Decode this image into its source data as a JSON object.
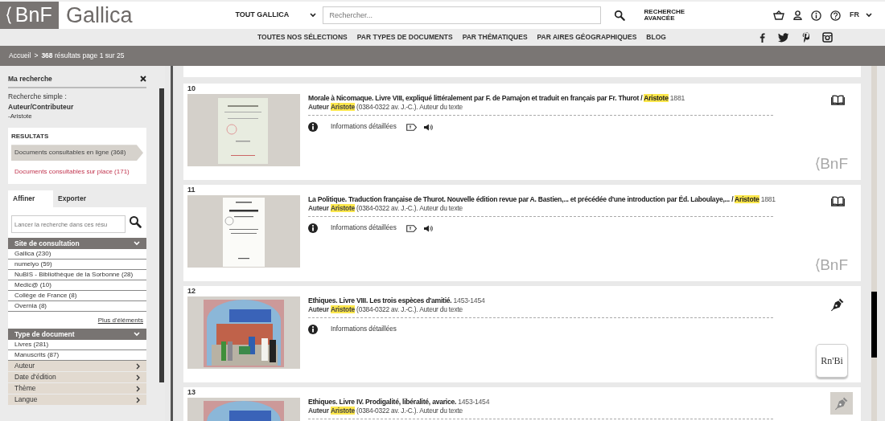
{
  "header": {
    "logo": "BnF",
    "site_name": "Gallica",
    "scope": "TOUT GALLICA",
    "search_placeholder": "Rechercher...",
    "advanced_search": "RECHERCHE AVANCÉE",
    "language": "FR"
  },
  "nav": [
    "TOUTES NOS SÉLECTIONS",
    "PAR TYPES DE DOCUMENTS",
    "PAR THÉMATIQUES",
    "PAR AIRES GÉOGRAPHIQUES",
    "BLOG"
  ],
  "breadcrumb": {
    "home": "Accueil",
    "separator": ">",
    "summary": "**368** résultats page 1 sur 25"
  },
  "sidebar": {
    "title": "Ma recherche",
    "query_type": "Recherche simple :",
    "query_field": "Auteur/Contributeur",
    "query_value": "-Aristote",
    "results_heading": "RESULTATS",
    "result_sets": [
      {
        "label": "Documents consultables en ligne (368)",
        "selected": true
      },
      {
        "label": "Documents consultables sur place (171)",
        "selected": false
      }
    ],
    "tabs": [
      {
        "label": "Affiner",
        "selected": true
      },
      {
        "label": "Exporter",
        "selected": false
      }
    ],
    "filter_placeholder": "Lancer la recherche dans ces résu",
    "facets": [
      {
        "title": "Site de consultation",
        "expanded": true,
        "items": [
          "Gallica (230)",
          "numelyo (59)",
          "NuBIS - Bibliothèque de la Sorbonne (28)",
          "Medic@ (10)",
          "Collège de France (8)",
          "Overnia (8)"
        ],
        "more": "Plus d'éléments"
      },
      {
        "title": "Type de document",
        "expanded": true,
        "items": [
          "Livres (281)",
          "Manuscrits (87)"
        ]
      },
      {
        "title": "Auteur",
        "expanded": false
      },
      {
        "title": "Date d'édition",
        "expanded": false
      },
      {
        "title": "Thème",
        "expanded": false
      },
      {
        "title": "Langue",
        "expanded": false
      }
    ]
  },
  "results": [
    {
      "number": "10",
      "title": "Morale à Nicomaque. Livre VIII, expliqué littéralement par F. de Parnajon et traduit en français par Fr. Thurot / ",
      "title_author": "Aristote",
      "date": "1881",
      "author_label": "Auteur",
      "author_name": "Aristote",
      "author_rest": "(0384-0322 av. J.-C.). Auteur du texte",
      "details": "Informations détaillées",
      "actions": [
        {
          "kind": "tag"
        },
        {
          "kind": "audio"
        }
      ],
      "type_icon": {
        "kind": "book"
      },
      "icon_dimmed": false,
      "provider": {
        "kind": "bnf",
        "label": "BnF"
      }
    },
    {
      "number": "11",
      "title": "La Politique. Traduction française de Thurot. Nouvelle édition revue par A. Bastien,... et précédée d'une introduction par Éd. Laboulaye,... / ",
      "title_author": "Aristote",
      "date": "1881",
      "author_label": "Auteur",
      "author_name": "Aristote",
      "author_rest": "(0384-0322 av. J.-C.). Auteur du texte",
      "details": "Informations détaillées",
      "actions": [
        {
          "kind": "tag"
        },
        {
          "kind": "audio"
        }
      ],
      "type_icon": {
        "kind": "book"
      },
      "icon_dimmed": false,
      "provider": {
        "kind": "bnf",
        "label": "BnF"
      }
    },
    {
      "number": "12",
      "title": "Ethiques. Livre VIII. Les trois espèces d'amitié.",
      "date": "1453-1454",
      "author_label": "Auteur",
      "author_name": "Aristote",
      "author_rest": "(0384-0322 av. J.-C.). Auteur du texte",
      "details": "Informations détaillées",
      "type_icon": {
        "kind": "pen"
      },
      "icon_dimmed": false,
      "provider": {
        "kind": "rnbi",
        "label": "Rn'Bi"
      }
    },
    {
      "number": "13",
      "title": "Ethiques. Livre IV. Prodigalité, libéralité, avarice.",
      "date": "1453-1454",
      "author_label": "Auteur",
      "author_name": "Aristote",
      "author_rest": "(0384-0322 av. J.-C.). Auteur du texte",
      "type_icon": {
        "kind": "pen"
      },
      "icon_dimmed": true
    }
  ]
}
